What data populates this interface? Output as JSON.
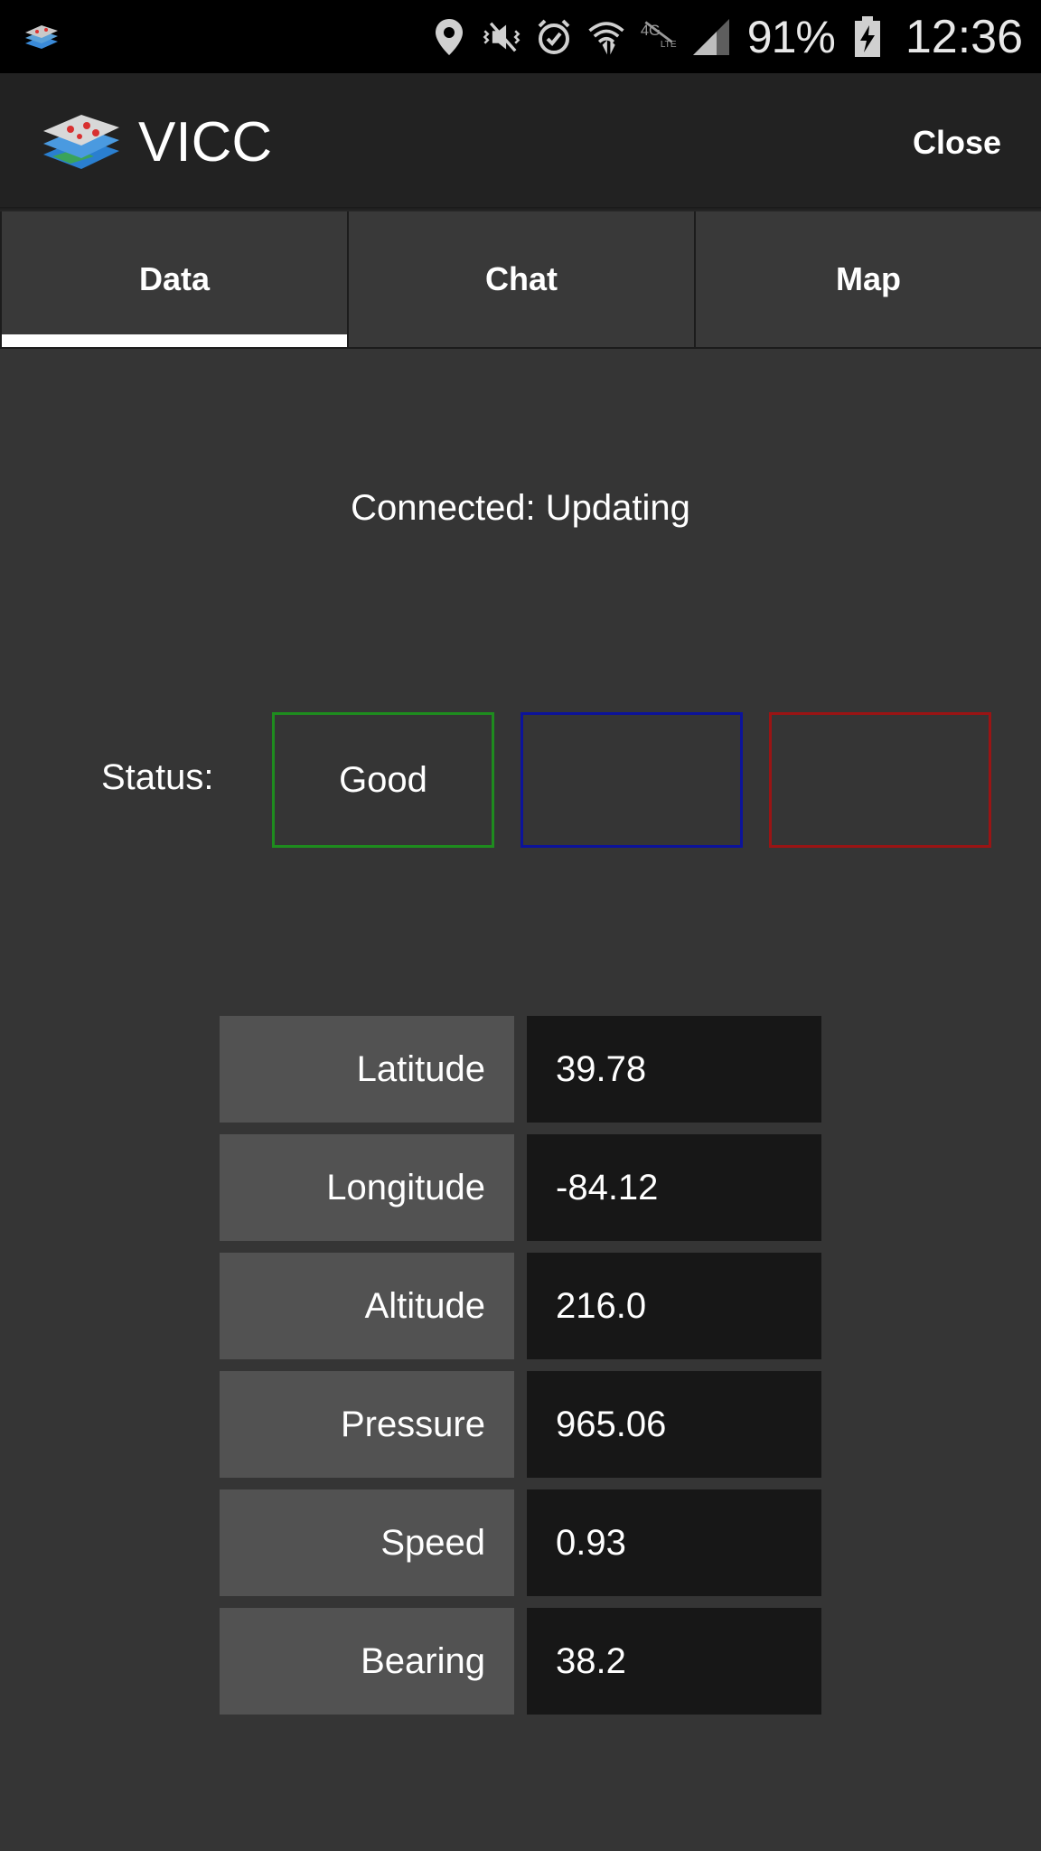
{
  "status_bar": {
    "battery_percent": "91%",
    "time": "12:36",
    "icons": [
      "location-icon",
      "vibrate-mute-icon",
      "alarm-icon",
      "wifi-icon",
      "lte-data-icon",
      "signal-icon",
      "battery-charging-icon"
    ]
  },
  "app_bar": {
    "title": "VICC",
    "close_label": "Close"
  },
  "tabs": [
    {
      "label": "Data",
      "selected": true
    },
    {
      "label": "Chat",
      "selected": false
    },
    {
      "label": "Map",
      "selected": false
    }
  ],
  "connection": {
    "text": "Connected: Updating"
  },
  "status": {
    "label": "Status:",
    "boxes": [
      {
        "text": "Good",
        "color": "#1e8c1e"
      },
      {
        "text": "",
        "color": "#0c139a"
      },
      {
        "text": "",
        "color": "#9a1414"
      }
    ]
  },
  "readings": [
    {
      "label": "Latitude",
      "value": "39.78"
    },
    {
      "label": "Longitude",
      "value": "-84.12"
    },
    {
      "label": "Altitude",
      "value": "216.0"
    },
    {
      "label": "Pressure",
      "value": "965.06"
    },
    {
      "label": "Speed",
      "value": "0.93"
    },
    {
      "label": "Bearing",
      "value": "38.2"
    }
  ],
  "colors": {
    "background": "#353535",
    "app_bar": "#222222",
    "tab_indicator": "#ffffff",
    "key_cell": "#525252",
    "value_cell": "#171717"
  }
}
